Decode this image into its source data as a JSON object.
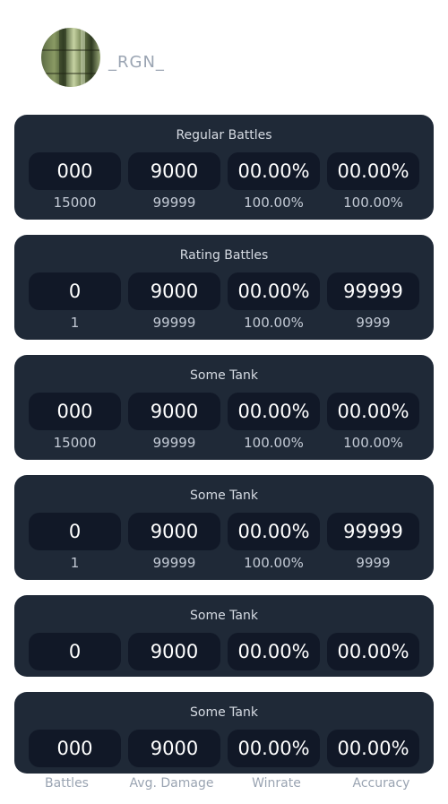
{
  "profile": {
    "username": "_RGN_"
  },
  "cards": [
    {
      "title": "Regular Battles",
      "values": [
        "000",
        "9000",
        "00.00%",
        "00.00%"
      ],
      "subs": [
        "15000",
        "99999",
        "100.00%",
        "100.00%"
      ]
    },
    {
      "title": "Rating Battles",
      "values": [
        "0",
        "9000",
        "00.00%",
        "99999"
      ],
      "subs": [
        "1",
        "99999",
        "100.00%",
        "9999"
      ]
    },
    {
      "title": "Some Tank",
      "values": [
        "000",
        "9000",
        "00.00%",
        "00.00%"
      ],
      "subs": [
        "15000",
        "99999",
        "100.00%",
        "100.00%"
      ]
    },
    {
      "title": "Some Tank",
      "values": [
        "0",
        "9000",
        "00.00%",
        "99999"
      ],
      "subs": [
        "1",
        "99999",
        "100.00%",
        "9999"
      ]
    },
    {
      "title": "Some Tank",
      "values": [
        "0",
        "9000",
        "00.00%",
        "00.00%"
      ]
    },
    {
      "title": "Some Tank",
      "values": [
        "000",
        "9000",
        "00.00%",
        "00.00%"
      ]
    }
  ],
  "columns": [
    "Battles",
    "Avg. Damage",
    "Winrate",
    "Accuracy"
  ]
}
